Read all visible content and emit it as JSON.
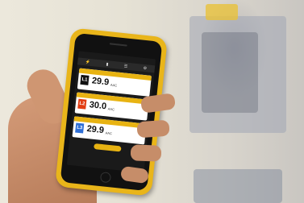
{
  "colors": {
    "case_yellow": "#e9b51a",
    "accent_yellow": "#e8b312",
    "phase_l1": "#111111",
    "phase_l2": "#e23c12",
    "phase_l3": "#2f6fd6"
  },
  "app": {
    "status_text": "",
    "toolbar_icons": [
      "voltage-icon",
      "hold-icon",
      "list-icon",
      "gear-icon"
    ],
    "readings": [
      {
        "header": "",
        "phase": "L1",
        "value": "29.9",
        "unit": "AAC"
      },
      {
        "header": "",
        "phase": "L2",
        "value": "30.0",
        "unit": "AAC"
      },
      {
        "header": "",
        "phase": "L3",
        "value": "29.9",
        "unit": "AAC"
      }
    ],
    "capture_button": ""
  }
}
